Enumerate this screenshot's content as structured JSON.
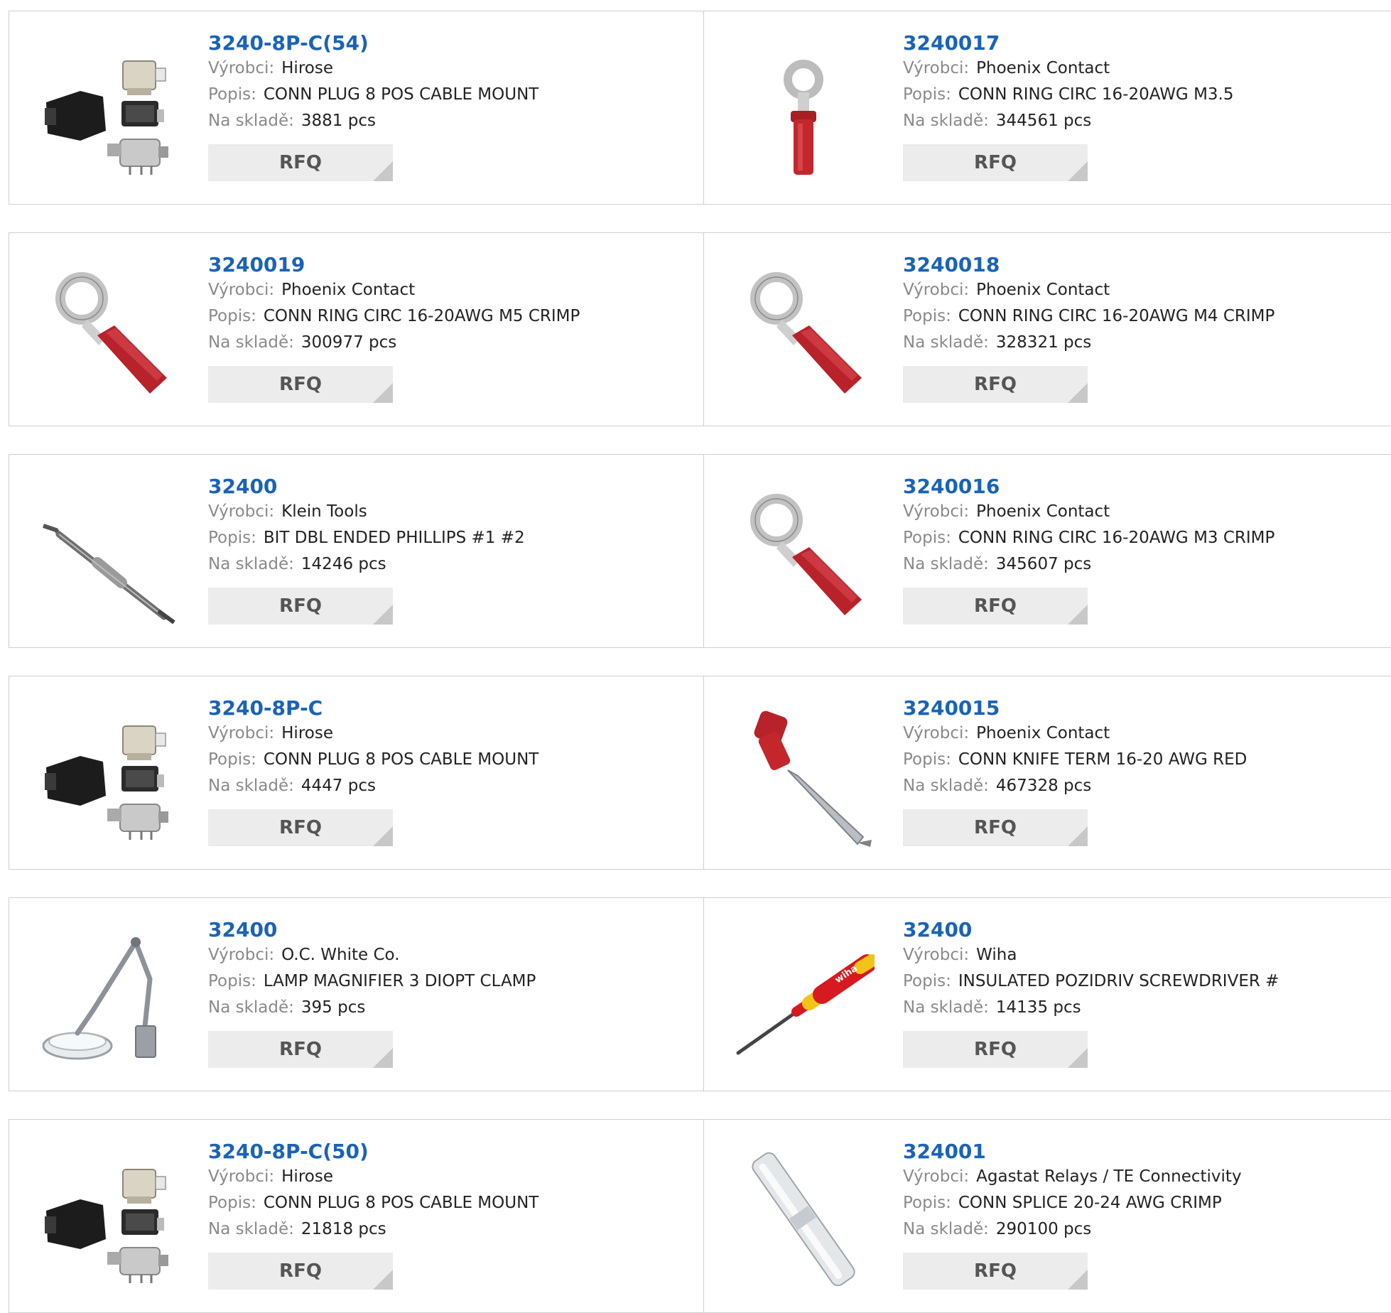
{
  "labels": {
    "manufacturer": "Výrobci:",
    "description": "Popis:",
    "stock": "Na skladě:",
    "rfq": "RFQ"
  },
  "products": [
    {
      "pn": "3240-8P-C(54)",
      "manufacturer": "Hirose",
      "description": "CONN PLUG 8 POS CABLE MOUNT",
      "stock": "3881 pcs",
      "image": "connector-kit"
    },
    {
      "pn": "3240017",
      "manufacturer": "Phoenix Contact",
      "description": "CONN RING CIRC 16-20AWG M3.5",
      "stock": "344561 pcs",
      "image": "ring-terminal-upright"
    },
    {
      "pn": "3240019",
      "manufacturer": "Phoenix Contact",
      "description": "CONN RING CIRC 16-20AWG M5 CRIMP",
      "stock": "300977 pcs",
      "image": "ring-terminal"
    },
    {
      "pn": "3240018",
      "manufacturer": "Phoenix Contact",
      "description": "CONN RING CIRC 16-20AWG M4 CRIMP",
      "stock": "328321 pcs",
      "image": "ring-terminal"
    },
    {
      "pn": "32400",
      "manufacturer": "Klein Tools",
      "description": "BIT DBL ENDED PHILLIPS #1 #2",
      "stock": "14246 pcs",
      "image": "double-bit"
    },
    {
      "pn": "3240016",
      "manufacturer": "Phoenix Contact",
      "description": "CONN RING CIRC 16-20AWG M3 CRIMP",
      "stock": "345607 pcs",
      "image": "ring-terminal"
    },
    {
      "pn": "3240-8P-C",
      "manufacturer": "Hirose",
      "description": "CONN PLUG 8 POS CABLE MOUNT",
      "stock": "4447 pcs",
      "image": "connector-kit"
    },
    {
      "pn": "3240015",
      "manufacturer": "Phoenix Contact",
      "description": "CONN KNIFE TERM 16-20 AWG RED",
      "stock": "467328 pcs",
      "image": "knife-terminal"
    },
    {
      "pn": "32400",
      "manufacturer": "O.C. White Co.",
      "description": "LAMP MAGNIFIER 3 DIOPT CLAMP",
      "stock": "395 pcs",
      "image": "magnifier-lamp"
    },
    {
      "pn": "32400",
      "manufacturer": "Wiha",
      "description": "INSULATED POZIDRIV SCREWDRIVER #",
      "stock": "14135 pcs",
      "image": "screwdriver",
      "brand": "wiha"
    },
    {
      "pn": "3240-8P-C(50)",
      "manufacturer": "Hirose",
      "description": "CONN PLUG 8 POS CABLE MOUNT",
      "stock": "21818 pcs",
      "image": "connector-kit"
    },
    {
      "pn": "324001",
      "manufacturer": "Agastat Relays / TE Connectivity",
      "description": "CONN SPLICE 20-24 AWG CRIMP",
      "stock": "290100 pcs",
      "image": "butt-splice"
    }
  ]
}
